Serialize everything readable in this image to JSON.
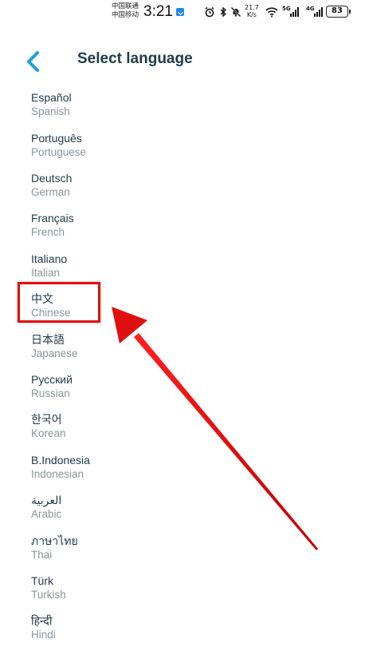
{
  "status_bar": {
    "carrier1": "中国联通",
    "carrier2": "中国移动",
    "time": "3:21",
    "net_speed_value": "21.7",
    "net_speed_unit": "K/s",
    "signal1_label": "5G",
    "signal2_label": "4G",
    "battery": "83"
  },
  "header": {
    "title": "Select language"
  },
  "languages": [
    {
      "native": "Español",
      "english": "Spanish"
    },
    {
      "native": "Português",
      "english": "Portuguese"
    },
    {
      "native": "Deutsch",
      "english": "German"
    },
    {
      "native": "Français",
      "english": "French"
    },
    {
      "native": "Italiano",
      "english": "Italian"
    },
    {
      "native": "中文",
      "english": "Chinese"
    },
    {
      "native": "日本語",
      "english": "Japanese"
    },
    {
      "native": "Русский",
      "english": "Russian"
    },
    {
      "native": "한국어",
      "english": "Korean"
    },
    {
      "native": "B.Indonesia",
      "english": "Indonesian"
    },
    {
      "native": "العربية",
      "english": "Arabic"
    },
    {
      "native": "ภาษาไทย",
      "english": "Thai"
    },
    {
      "native": "Türk",
      "english": "Turkish"
    },
    {
      "native": "हिन्दी",
      "english": "Hindi"
    }
  ],
  "colors": {
    "accent": "#1aa0d8",
    "title": "#1f3a4a",
    "annotation": "#e01010"
  },
  "icons": {
    "back": "chevron-left-icon"
  }
}
